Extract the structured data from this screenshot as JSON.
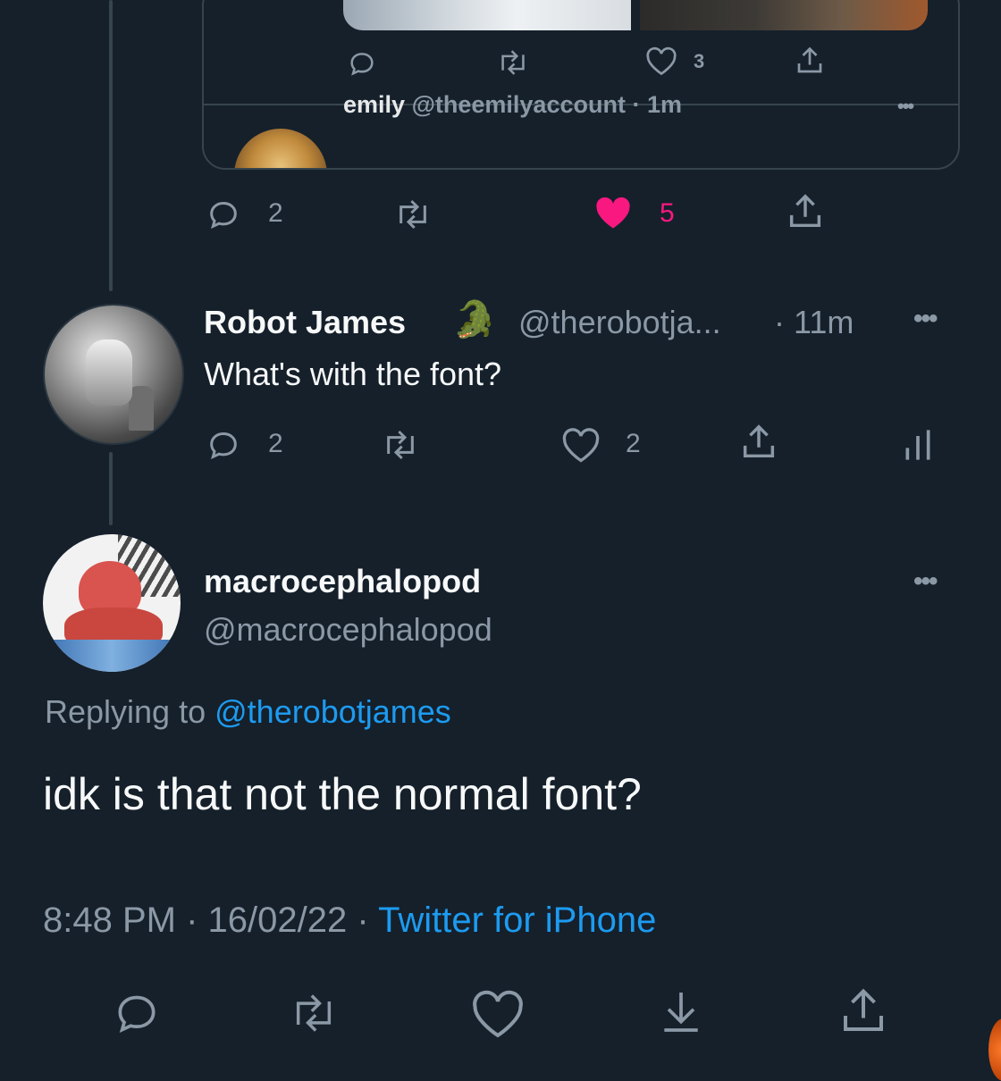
{
  "quoted": {
    "actions": {
      "like_count": "3"
    },
    "nested": {
      "name": "emily",
      "handle": "@theemilyaccount",
      "time": "· 1m",
      "more": "•••"
    }
  },
  "top_tweet_actions": {
    "reply_count": "2",
    "like_count": "5",
    "liked": true
  },
  "reply": {
    "name": "Robot James",
    "emoji": "🐊",
    "handle": "@therobotja...",
    "time": "· 11m",
    "text": "What's with the font?",
    "more": "•••",
    "reply_count": "2",
    "like_count": "2"
  },
  "main_tweet": {
    "name": "macrocephalopod",
    "handle": "@macrocephalopod",
    "more": "•••",
    "replying_prefix": "Replying to",
    "replying_mention": "@therobotjames",
    "text": "idk is that not the normal font?",
    "time": "8:48 PM",
    "sep1": "·",
    "date": "16/02/22",
    "sep2": "·",
    "source": "Twitter for iPhone"
  },
  "colors": {
    "background": "#15202b",
    "muted": "#8b98a5",
    "accent": "#1d9bf0",
    "like": "#f91880",
    "border": "#38444d"
  }
}
